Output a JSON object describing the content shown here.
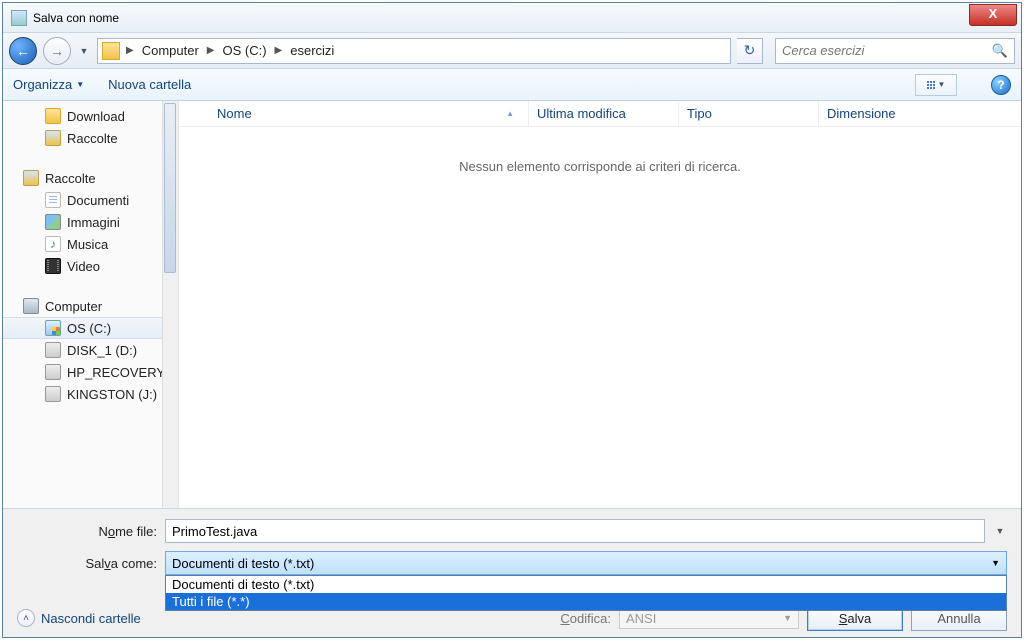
{
  "window": {
    "title": "Salva con nome"
  },
  "nav": {
    "crumb1": "Computer",
    "crumb2": "OS (C:)",
    "crumb3": "esercizi",
    "search_placeholder": "Cerca esercizi"
  },
  "toolbar": {
    "organize": "Organizza",
    "newfolder": "Nuova cartella"
  },
  "sidebar": {
    "download": "Download",
    "raccolte_top": "Raccolte",
    "raccolte_grp": "Raccolte",
    "documenti": "Documenti",
    "immagini": "Immagini",
    "musica": "Musica",
    "video": "Video",
    "computer": "Computer",
    "os": "OS (C:)",
    "disk1": "DISK_1 (D:)",
    "hprec": "HP_RECOVERY",
    "kingston": "KINGSTON (J:)"
  },
  "columns": {
    "name": "Nome",
    "modified": "Ultima modifica",
    "type": "Tipo",
    "size": "Dimensione"
  },
  "main": {
    "empty": "Nessun elemento corrisponde ai criteri di ricerca."
  },
  "form": {
    "filename_lbl_pre": "N",
    "filename_lbl_u": "o",
    "filename_lbl_post": "me file:",
    "filename_val": "PrimoTest.java",
    "saveas_lbl_pre": "Sal",
    "saveas_lbl_u": "v",
    "saveas_lbl_post": "a come:",
    "saveas_val": "Documenti di testo (*.txt)",
    "opt1": "Documenti di testo (*.txt)",
    "opt2": "Tutti i file  (*.*)",
    "hide": "Nascondi cartelle",
    "encoding_lbl_pre": "",
    "encoding_lbl_u": "C",
    "encoding_lbl_post": "odifica:",
    "encoding_val": "ANSI",
    "save_pre": "",
    "save_u": "S",
    "save_post": "alva",
    "cancel": "Annulla"
  }
}
